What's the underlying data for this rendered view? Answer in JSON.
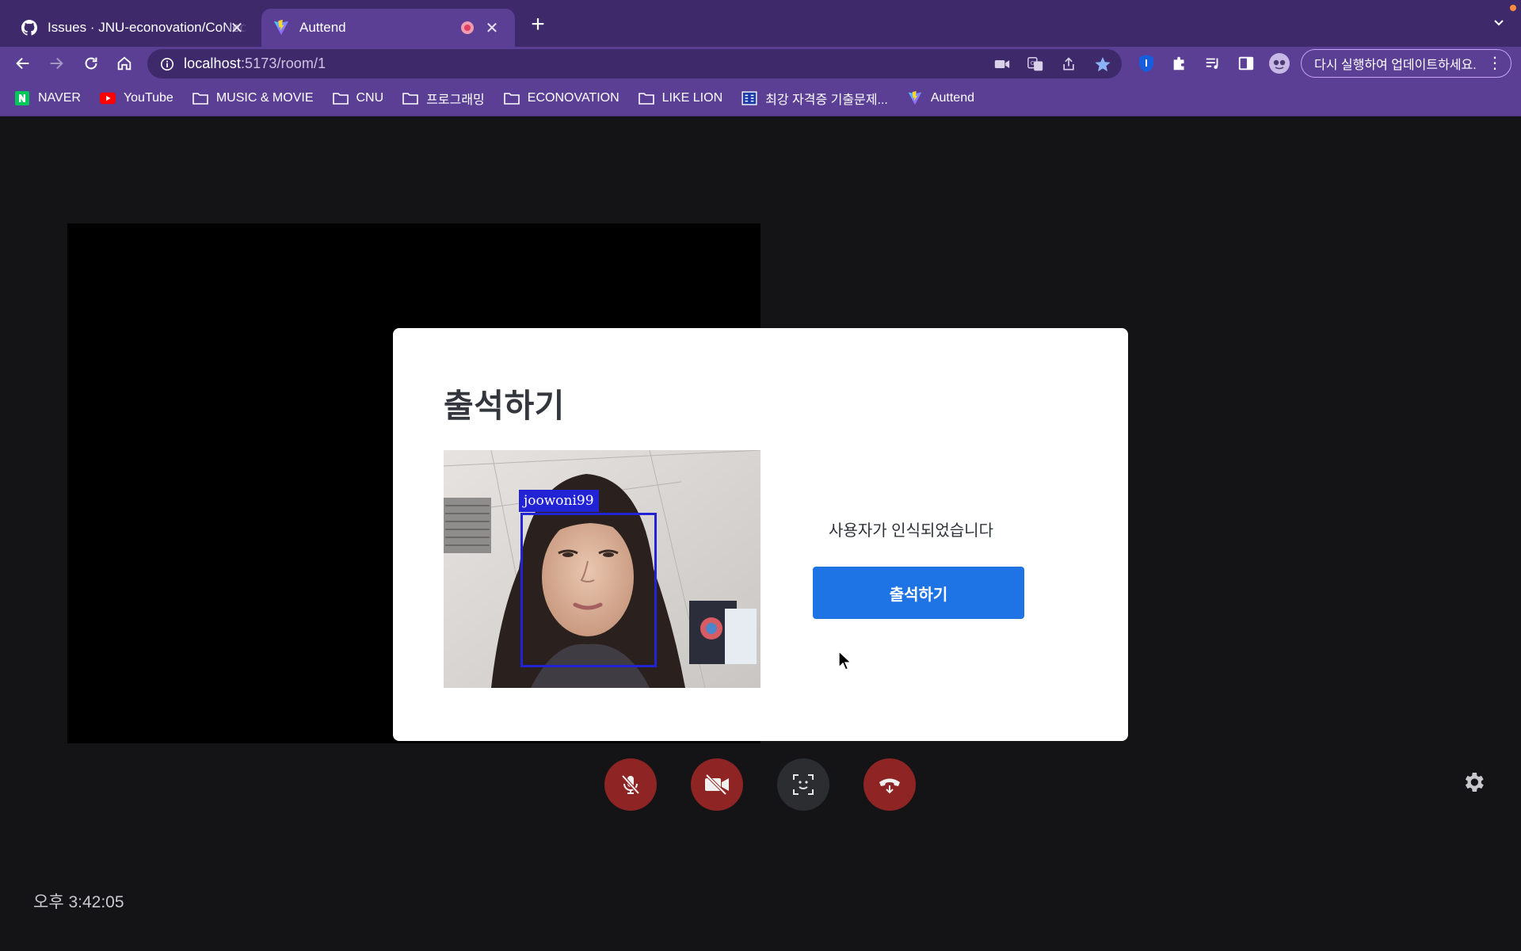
{
  "browser": {
    "tabs": [
      {
        "title": "Issues · JNU-econovation/CoNect",
        "favicon": "github-icon"
      },
      {
        "title": "Auttend",
        "favicon": "vite-icon",
        "recording": true
      }
    ],
    "address": {
      "host": "localhost",
      "path": ":5173/room/1"
    },
    "update_label": "다시 실행하여 업데이트하세요.",
    "bookmarks": [
      {
        "label": "NAVER",
        "icon": "naver-icon"
      },
      {
        "label": "YouTube",
        "icon": "youtube-icon"
      },
      {
        "label": "MUSIC & MOVIE",
        "icon": "folder-icon"
      },
      {
        "label": "CNU",
        "icon": "folder-icon"
      },
      {
        "label": "프로그래밍",
        "icon": "folder-icon"
      },
      {
        "label": "ECONOVATION",
        "icon": "folder-icon"
      },
      {
        "label": "LIKE LION",
        "icon": "folder-icon"
      },
      {
        "label": "최강 자격증 기출문제...",
        "icon": "gsc-icon"
      },
      {
        "label": "Auttend",
        "icon": "vite-icon"
      }
    ]
  },
  "modal": {
    "title": "출석하기",
    "face_label": "joowoni99",
    "status": "사용자가 인식되었습니다",
    "button_label": "출석하기"
  },
  "controls": {
    "clock": "오후 3:42:05",
    "buttons": [
      "mic-off-icon",
      "camera-off-icon",
      "face-scan-icon",
      "hang-up-icon",
      "gear-icon"
    ]
  },
  "colors": {
    "tabstrip": "#3e2a6a",
    "toolbar": "#5a3f95",
    "page_bg": "#141416",
    "primary_button": "#1f74e5",
    "danger_control": "#8f2424",
    "face_box": "#2323d6"
  }
}
